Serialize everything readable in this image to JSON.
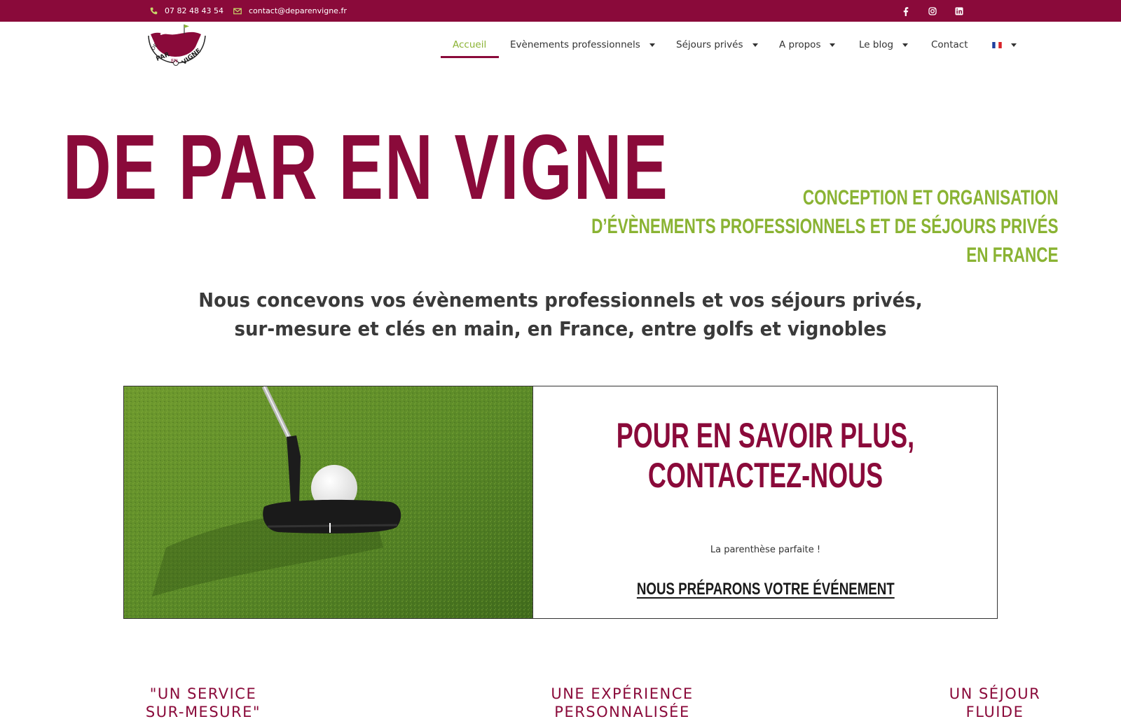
{
  "topbar": {
    "phone": "07 82 48 43 54",
    "email": "contact@deparenvigne.fr",
    "phone_icon": "phone-icon",
    "email_icon": "envelope-icon",
    "social": [
      "facebook-icon",
      "instagram-icon",
      "linkedin-icon"
    ],
    "background": "#8a0a3a"
  },
  "logo": {
    "text_de": "DE",
    "text_par": "PAR",
    "text_en": "EN",
    "text_vigne": "VIGNE"
  },
  "nav": {
    "items": [
      {
        "label": "Accueil",
        "active": true,
        "dropdown": false
      },
      {
        "label": "Evènements professionnels",
        "active": false,
        "dropdown": true
      },
      {
        "label": "Séjours privés",
        "active": false,
        "dropdown": true
      },
      {
        "label": "A propos",
        "active": false,
        "dropdown": true
      },
      {
        "label": "Le blog",
        "active": false,
        "dropdown": true
      },
      {
        "label": "Contact",
        "active": false,
        "dropdown": false
      }
    ],
    "language_icon": "french-flag-icon"
  },
  "hero": {
    "title": "DE PAR EN VIGNE",
    "subtitle_lines": [
      "CONCEPTION ET ORGANISATION",
      "D’ÉVÈNEMENTS PROFESSIONNELS ET DE SÉJOURS PRIVÉS",
      "EN FRANCE"
    ]
  },
  "intro": {
    "lines": [
      "Nous concevons vos évènements professionnels et vos séjours privés,",
      "sur-mesure et clés en main, en France, entre golfs et vignobles"
    ]
  },
  "cta_card": {
    "image": "golf-putter-and-ball-photo",
    "heading_lines": [
      "POUR EN SAVOIR PLUS,",
      "CONTACTEZ-NOUS"
    ],
    "tagline": "La parenthèse parfaite !",
    "link_label": "NOUS PRÉPARONS VOTRE ÉVÉNEMENT"
  },
  "features": [
    {
      "lines": [
        "\"UN SERVICE",
        "SUR-MESURE\""
      ]
    },
    {
      "lines": [
        "UNE EXPÉRIENCE",
        "PERSONNALISÉE"
      ]
    },
    {
      "lines": [
        "UN SÉJOUR",
        "FLUIDE"
      ]
    }
  ],
  "colors": {
    "brand": "#8a0a3a",
    "accent": "#8ab333",
    "text": "#333333"
  }
}
